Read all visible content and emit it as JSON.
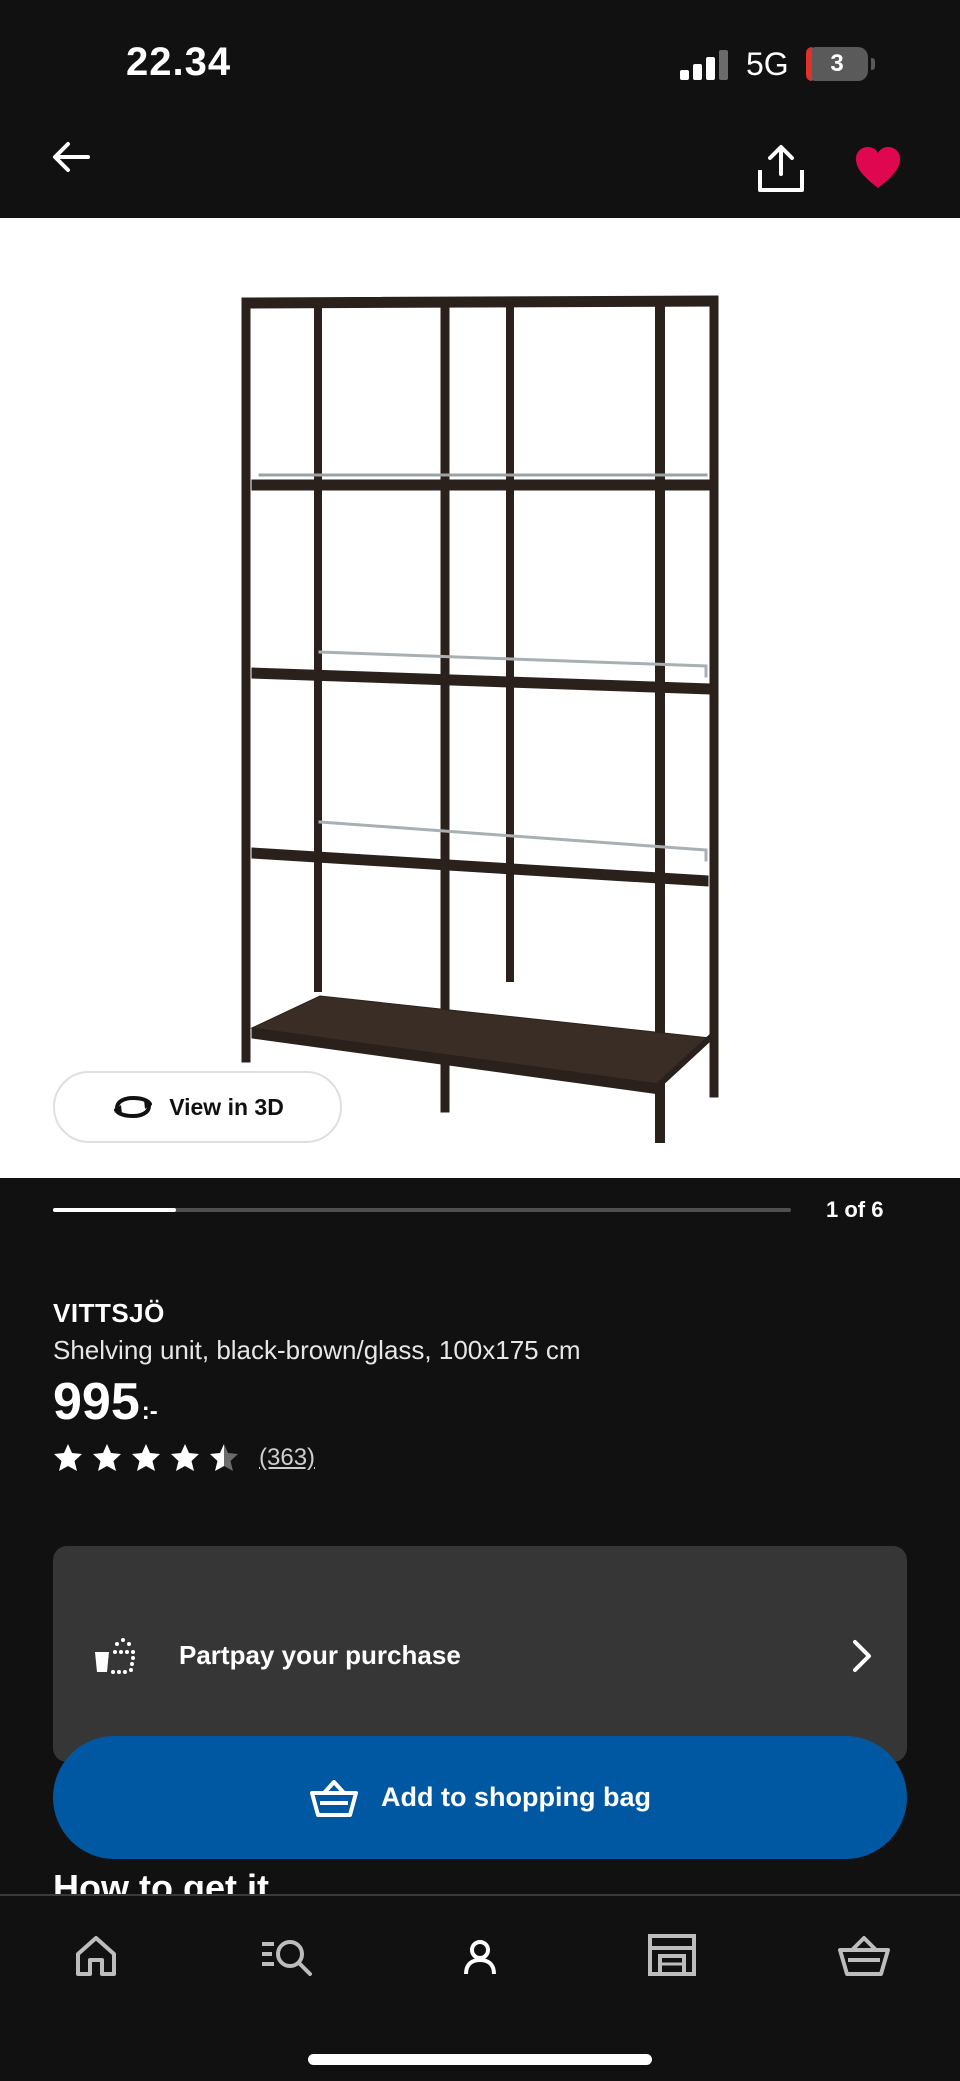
{
  "status_bar": {
    "time": "22.34",
    "network": "5G",
    "battery_level": "3"
  },
  "app_bar": {
    "back_icon": "arrow-left-icon",
    "share_icon": "share-icon",
    "favourite_icon": "heart-icon",
    "favourite_color": "#e00751"
  },
  "gallery": {
    "view_3d_label": "View in 3D",
    "position_label": "1 of 6",
    "progress": 0.166
  },
  "product": {
    "brand": "VITTSJÖ",
    "description": "Shelving unit, black-brown/glass, 100x175 cm",
    "price": "995",
    "price_suffix": ":-",
    "rating": 4.5,
    "rating_max": 5,
    "review_count": "(363)"
  },
  "partpay": {
    "label": "Partpay your purchase",
    "icon": "payment-basket-icon"
  },
  "cta": {
    "label": "Add to shopping bag",
    "icon": "shopping-bag-icon",
    "color": "#0058a3"
  },
  "section_heading": "How to get it",
  "bottom_nav": [
    {
      "icon": "home-icon"
    },
    {
      "icon": "search-icon"
    },
    {
      "icon": "profile-icon"
    },
    {
      "icon": "store-icon"
    },
    {
      "icon": "basket-icon"
    }
  ]
}
